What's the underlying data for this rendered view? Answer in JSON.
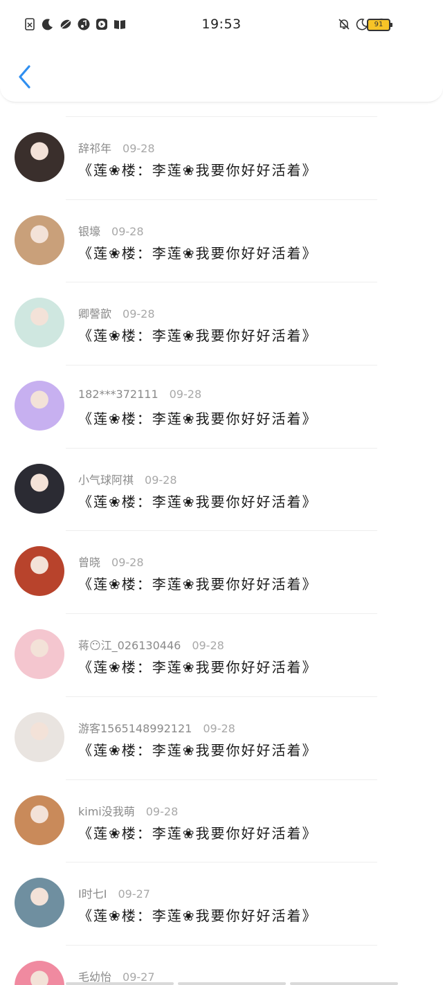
{
  "status_bar": {
    "time": "19:53",
    "battery": "91",
    "left_icons": [
      "sim-off-icon",
      "moon-icon",
      "leaf-icon",
      "music-icon",
      "video-icon",
      "book-icon"
    ],
    "right_icons": [
      "bell-off-icon",
      "do-not-disturb-icon",
      "wifi-icon"
    ]
  },
  "colors": {
    "accent": "#2f8ff0",
    "battery": "#f7c427"
  },
  "comments": [
    {
      "user": "辞祁年",
      "date": "09-28",
      "text": "《莲❀楼：李莲❀我要你好好活着》",
      "avatar_color": "#3a2f2c"
    },
    {
      "user": "银壕",
      "date": "09-28",
      "text": "《莲❀楼：李莲❀我要你好好活着》",
      "avatar_color": "#c9a07a"
    },
    {
      "user": "卿謦歆",
      "date": "09-28",
      "text": "《莲❀楼：李莲❀我要你好好活着》",
      "avatar_color": "#cfe7e0"
    },
    {
      "user": "182***372111",
      "date": "09-28",
      "text": "《莲❀楼：李莲❀我要你好好活着》",
      "avatar_color": "#c7b0f0"
    },
    {
      "user": "小气球阿祺",
      "date": "09-28",
      "text": "《莲❀楼：李莲❀我要你好好活着》",
      "avatar_color": "#2b2b33"
    },
    {
      "user": "曾晓",
      "date": "09-28",
      "text": "《莲❀楼：李莲❀我要你好好活着》",
      "avatar_color": "#b8432c"
    },
    {
      "user": "蒋😶江_026130446",
      "date": "09-28",
      "text": "《莲❀楼：李莲❀我要你好好活着》",
      "avatar_color": "#f4c6cf"
    },
    {
      "user": "游客1565148992121",
      "date": "09-28",
      "text": "《莲❀楼：李莲❀我要你好好活着》",
      "avatar_color": "#e9e4e0"
    },
    {
      "user": "kimi没我萌",
      "date": "09-28",
      "text": "《莲❀楼：李莲❀我要你好好活着》",
      "avatar_color": "#c98a5a"
    },
    {
      "user": "I时七I",
      "date": "09-27",
      "text": "《莲❀楼：李莲❀我要你好好活着》",
      "avatar_color": "#6f8fa0"
    },
    {
      "user": "毛幼怡",
      "date": "09-27",
      "text": "",
      "avatar_color": "#f08aa0"
    }
  ]
}
